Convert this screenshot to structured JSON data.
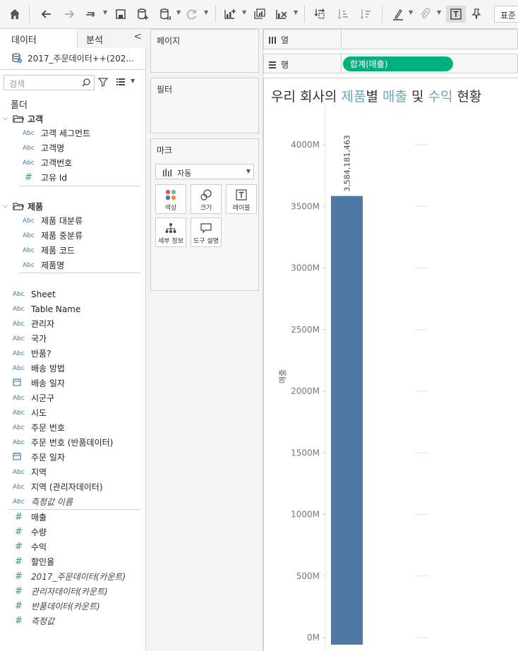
{
  "toolbar": {
    "fit_label": "표준"
  },
  "data_pane": {
    "tab_data": "데이터",
    "tab_analysis": "분석",
    "collapse_glyph": "<",
    "source_name": "2017_주문데이터++(202...",
    "search_placeholder": "검색",
    "folders_label": "폴더",
    "groups": [
      {
        "name": "고객",
        "fields": [
          {
            "type": "Abc",
            "name": "고객 세그먼트"
          },
          {
            "type": "Abc",
            "name": "고객명"
          },
          {
            "type": "Abc",
            "name": "고객번호"
          },
          {
            "type": "#",
            "name": "고유 Id"
          }
        ]
      },
      {
        "name": "제품",
        "fields": [
          {
            "type": "Abc",
            "name": "제품 대분류"
          },
          {
            "type": "Abc",
            "name": "제품 중분류"
          },
          {
            "type": "Abc",
            "name": "제품 코드"
          },
          {
            "type": "Abc",
            "name": "제품명"
          }
        ]
      }
    ],
    "dimensions": [
      {
        "type": "Abc",
        "name": "Sheet"
      },
      {
        "type": "Abc",
        "name": "Table Name"
      },
      {
        "type": "Abc",
        "name": "관리자"
      },
      {
        "type": "Abc",
        "name": "국가"
      },
      {
        "type": "Abc",
        "name": "반품?"
      },
      {
        "type": "Abc",
        "name": "배송 방법"
      },
      {
        "type": "date",
        "name": "배송 일자"
      },
      {
        "type": "Abc",
        "name": "시군구"
      },
      {
        "type": "Abc",
        "name": "시도"
      },
      {
        "type": "Abc",
        "name": "주문 번호"
      },
      {
        "type": "Abc",
        "name": "주문 번호 (반품데이터)"
      },
      {
        "type": "date",
        "name": "주문 일자"
      },
      {
        "type": "Abc",
        "name": "지역"
      },
      {
        "type": "Abc",
        "name": "지역 (관리자데이터)"
      },
      {
        "type": "Abc",
        "name": "측정값 이름",
        "italic": true
      }
    ],
    "measures": [
      {
        "type": "#",
        "name": "매출"
      },
      {
        "type": "#",
        "name": "수량"
      },
      {
        "type": "#",
        "name": "수익"
      },
      {
        "type": "#",
        "name": "할인율"
      },
      {
        "type": "#",
        "name": "2017_주문데이터(카운트)",
        "italic": true
      },
      {
        "type": "#",
        "name": "관리자데이터(카운트)",
        "italic": true
      },
      {
        "type": "#",
        "name": "반품데이터(카운트)",
        "italic": true
      },
      {
        "type": "#",
        "name": "측정값",
        "italic": true
      }
    ]
  },
  "shelves": {
    "pages_label": "페이지",
    "filters_label": "필터",
    "marks_label": "마크",
    "mark_type": "자동",
    "mark_buttons": {
      "color": "색상",
      "size": "크기",
      "label": "레이블",
      "detail": "세부 정보",
      "tooltip": "도구 설명"
    },
    "columns_label": "열",
    "rows_label": "행",
    "rows_pill": "합계(매출)"
  },
  "view": {
    "title_parts": [
      {
        "text": "우리 회사의 ",
        "kw": false
      },
      {
        "text": "제품",
        "kw": true
      },
      {
        "text": "별 ",
        "kw": false
      },
      {
        "text": "매출",
        "kw": true
      },
      {
        "text": " 및 ",
        "kw": false
      },
      {
        "text": "수익",
        "kw": true
      },
      {
        "text": " 현황",
        "kw": false
      }
    ]
  },
  "colors": {
    "bar": "#4e79a7",
    "pill": "#00b180",
    "title_keyword": "#6da4b8"
  },
  "chart_data": {
    "type": "bar",
    "categories": [
      ""
    ],
    "values": [
      3584181463
    ],
    "data_labels": [
      "3,584,181,463"
    ],
    "ylabel": "매출",
    "ylim": [
      0,
      4000000000
    ],
    "yticks": [
      0,
      500000000,
      1000000000,
      1500000000,
      2000000000,
      2500000000,
      3000000000,
      3500000000,
      4000000000
    ],
    "ytick_labels": [
      "0M",
      "500M",
      "1000M",
      "1500M",
      "2000M",
      "2500M",
      "3000M",
      "3500M",
      "4000M"
    ],
    "grid": false
  }
}
